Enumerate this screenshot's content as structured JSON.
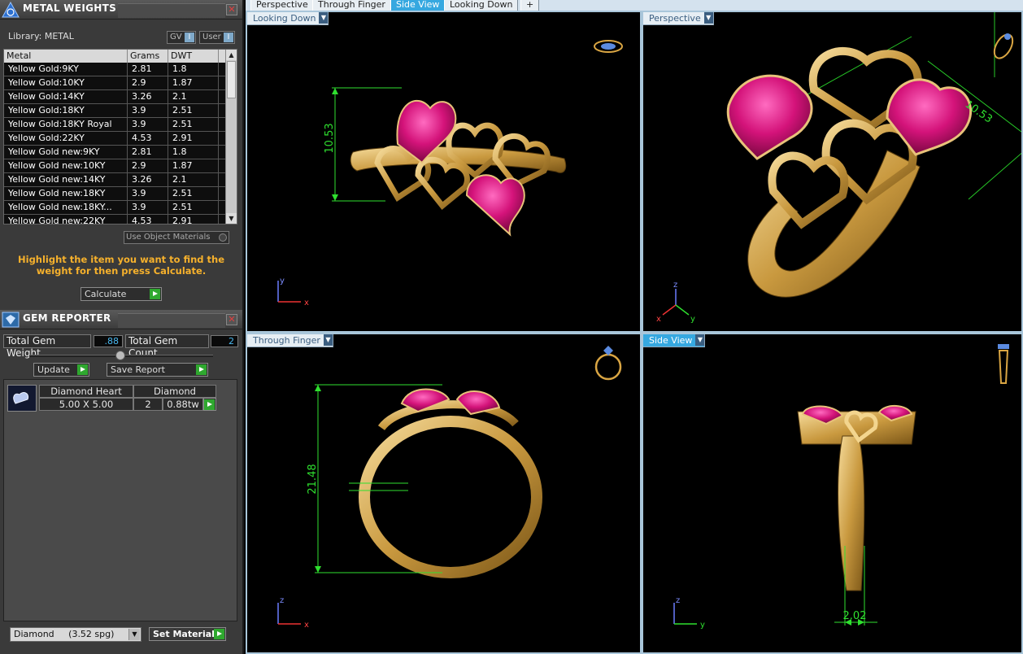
{
  "metal_panel": {
    "title": "METAL WEIGHTS",
    "close": "✕",
    "library_label": "Library: METAL",
    "gv_label": "GV",
    "user_label": "User",
    "columns": [
      "Metal",
      "Grams",
      "DWT"
    ],
    "rows": [
      {
        "metal": "Yellow Gold:9KY",
        "grams": "2.81",
        "dwt": "1.8"
      },
      {
        "metal": "Yellow Gold:10KY",
        "grams": "2.9",
        "dwt": "1.87"
      },
      {
        "metal": "Yellow Gold:14KY",
        "grams": "3.26",
        "dwt": "2.1"
      },
      {
        "metal": "Yellow Gold:18KY",
        "grams": "3.9",
        "dwt": "2.51"
      },
      {
        "metal": "Yellow Gold:18KY Royal",
        "grams": "3.9",
        "dwt": "2.51"
      },
      {
        "metal": "Yellow Gold:22KY",
        "grams": "4.53",
        "dwt": "2.91"
      },
      {
        "metal": "Yellow Gold new:9KY",
        "grams": "2.81",
        "dwt": "1.8"
      },
      {
        "metal": "Yellow Gold new:10KY",
        "grams": "2.9",
        "dwt": "1.87"
      },
      {
        "metal": "Yellow Gold new:14KY",
        "grams": "3.26",
        "dwt": "2.1"
      },
      {
        "metal": "Yellow Gold new:18KY",
        "grams": "3.9",
        "dwt": "2.51"
      },
      {
        "metal": "Yellow Gold new:18KY...",
        "grams": "3.9",
        "dwt": "2.51"
      },
      {
        "metal": "Yellow Gold new:22KY",
        "grams": "4.53",
        "dwt": "2.91"
      }
    ],
    "use_object_materials": "Use Object Materials",
    "hint": "Highlight the item you want to find the weight for then press Calculate.",
    "calculate_label": "Calculate"
  },
  "gem_panel": {
    "title": "GEM REPORTER",
    "close": "✕",
    "total_weight_label": "Total Gem Weight",
    "total_weight_value": ".88",
    "total_count_label": "Total Gem Count",
    "total_count_value": "2",
    "update_label": "Update",
    "save_report_label": "Save Report",
    "gem_name": "Diamond Heart",
    "gem_material": "Diamond",
    "gem_size": "5.00 X 5.00",
    "gem_qty": "2",
    "gem_weight": "0.88tw",
    "material_select": "Diamond     (3.52 spg)",
    "set_material_label": "Set Material"
  },
  "tabs": [
    "Perspective",
    "Through Finger",
    "Side View",
    "Looking Down",
    "+"
  ],
  "active_tab": "Side View",
  "viewports": {
    "top_left": {
      "label": "Looking Down",
      "dimension": "10.53",
      "axis_v": "y",
      "axis_h": "x"
    },
    "top_right": {
      "label": "Perspective",
      "dimension": "10.53",
      "axis_v": "z",
      "axis_h1": "x",
      "axis_h2": "y"
    },
    "bottom_left": {
      "label": "Through Finger",
      "dimension": "21.48",
      "axis_v": "z",
      "axis_h": "x"
    },
    "bottom_right": {
      "label": "Side View",
      "dimension": "2.02",
      "axis_v": "z",
      "axis_h": "y"
    }
  },
  "colors": {
    "gold": "#d9b36a",
    "ruby": "#d4137a",
    "dimension": "#2fe02f",
    "active_tab": "#36a8e0",
    "hint": "#f6b12c"
  },
  "icons": [
    "app-logo-icon",
    "gem-logo-icon",
    "close-icon",
    "play-arrow-icon",
    "dropdown-arrow-icon",
    "ring-orientation-icon",
    "axis-gizmo-icon"
  ]
}
